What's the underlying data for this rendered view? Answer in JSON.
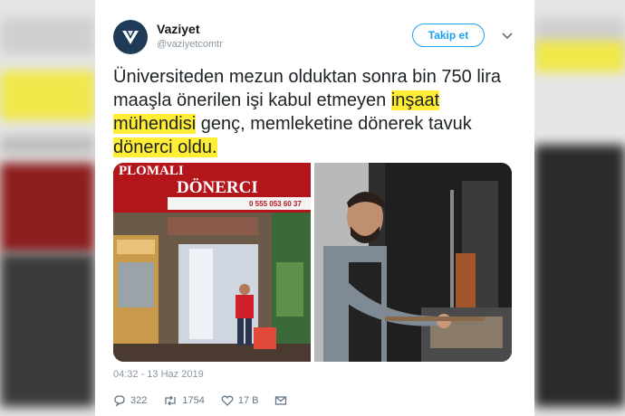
{
  "tweet": {
    "author_name": "Vaziyet",
    "author_handle": "@vaziyetcomtr",
    "follow_label": "Takip et",
    "text_parts": [
      {
        "text": "Üniversiteden mezun olduktan sonra bin 750 lira maaşla önerilen işi kabul etmeyen ",
        "highlight": false
      },
      {
        "text": "inşaat mühendisi",
        "highlight": true
      },
      {
        "text": " genç, memleketine dönerek tavuk ",
        "highlight": false
      },
      {
        "text": "dönerci oldu.",
        "highlight": true
      }
    ],
    "timestamp": "04:32 - 13 Haz 2019",
    "replies": "322",
    "retweets": "1754",
    "likes": "17 B",
    "shop_sign_top": "PLOMALI",
    "shop_sign_main": "DÖNERCI",
    "shop_phone": "0 555 053 60 37"
  },
  "colors": {
    "highlight": "#ffee33",
    "follow_accent": "#1da1f2",
    "avatar": "#1f3b57",
    "sign_red": "#b3151b"
  },
  "icons": [
    "vaziyet-logo-icon",
    "chevron-down-icon",
    "reply-icon",
    "retweet-icon",
    "like-icon",
    "message-icon"
  ]
}
